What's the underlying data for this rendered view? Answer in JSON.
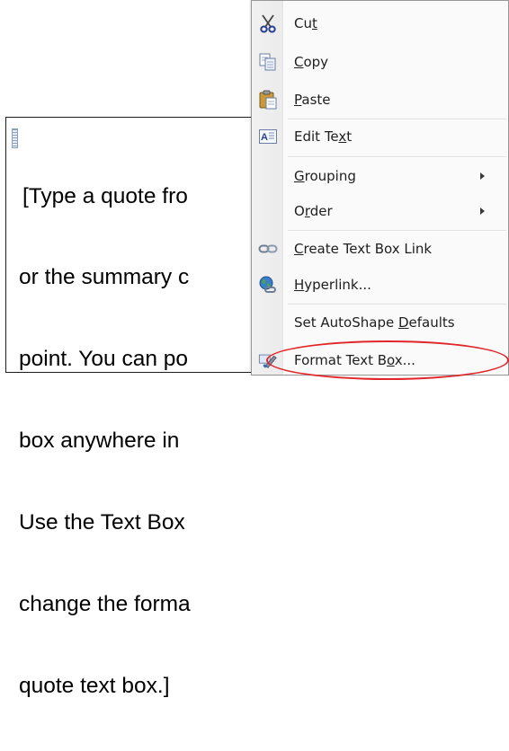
{
  "textbox": {
    "lines": [
      "[Type a quote fro",
      "or the summary c",
      "point. You can po",
      "box anywhere in",
      "Use the Text Box",
      "change the forma",
      "quote text box.]"
    ]
  },
  "menu": {
    "items": [
      {
        "id": "cut",
        "pre": "Cu",
        "acc": "t",
        "post": "",
        "icon": "scissors-icon"
      },
      {
        "id": "copy",
        "pre": "",
        "acc": "C",
        "post": "opy",
        "icon": "copy-icon"
      },
      {
        "id": "paste",
        "pre": "",
        "acc": "P",
        "post": "aste",
        "icon": "paste-icon"
      },
      {
        "id": "edit-text",
        "pre": "Edit Te",
        "acc": "x",
        "post": "t",
        "icon": "edit-text-icon"
      },
      {
        "id": "grouping",
        "pre": "",
        "acc": "G",
        "post": "rouping",
        "icon": "",
        "submenu": true
      },
      {
        "id": "order",
        "pre": "O",
        "acc": "r",
        "post": "der",
        "icon": "",
        "submenu": true
      },
      {
        "id": "create-text-box-link",
        "pre": "",
        "acc": "C",
        "post": "reate Text Box Link",
        "icon": "link-icon"
      },
      {
        "id": "hyperlink",
        "pre": "",
        "acc": "H",
        "post": "yperlink...",
        "icon": "hyperlink-globe-icon"
      },
      {
        "id": "set-autoshape-defaults",
        "pre": "Set AutoShape ",
        "acc": "D",
        "post": "efaults",
        "icon": ""
      },
      {
        "id": "format-text-box",
        "pre": "Format Text B",
        "acc": "o",
        "post": "x...",
        "icon": "format-brush-icon"
      }
    ]
  },
  "colors": {
    "highlight_ellipse": "#e0262a",
    "menu_background": "#fafafa",
    "menu_border": "#979797"
  }
}
